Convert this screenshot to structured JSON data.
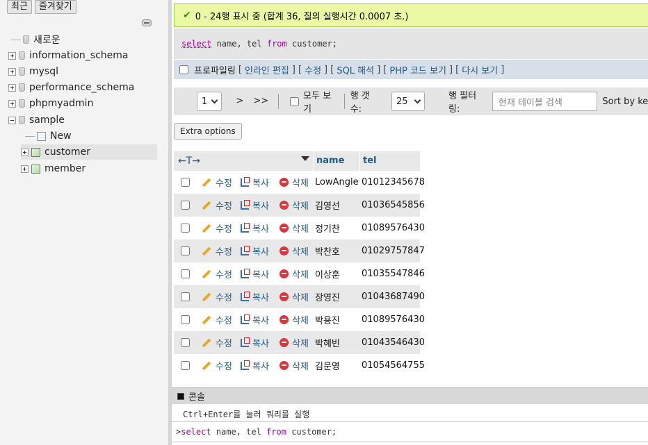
{
  "nav": {
    "tabs": [
      "최근",
      "즐겨찾기"
    ],
    "tree": [
      {
        "label": "새로운",
        "type": "new"
      },
      {
        "label": "information_schema",
        "type": "db"
      },
      {
        "label": "mysql",
        "type": "db"
      },
      {
        "label": "performance_schema",
        "type": "db"
      },
      {
        "label": "phpmyadmin",
        "type": "db"
      },
      {
        "label": "sample",
        "type": "db-open"
      },
      {
        "label": "New",
        "type": "table-new"
      },
      {
        "label": "customer",
        "type": "table",
        "selected": true
      },
      {
        "label": "member",
        "type": "table"
      }
    ]
  },
  "result": {
    "message": "0 - 24행 표시 중 (합계 36, 질의 실행시간 0.0007 초.)",
    "sql": {
      "k1": "select",
      "p1": " name, tel ",
      "k2": "from",
      "p2": " customer;"
    }
  },
  "profiling": {
    "label": "프로파일링",
    "links": [
      "인라인 편집",
      "수정",
      "SQL 해석",
      "PHP 코드 보기",
      "다시 보기"
    ]
  },
  "pager": {
    "page": "1",
    "next": ">",
    "last": ">>",
    "show_all": "모두 보기",
    "rows_label": "행 갯수:",
    "rows_value": "25",
    "filter_label": "행 필터링:",
    "filter_placeholder": "현재 테이블 검색",
    "sort_label": "Sort by key"
  },
  "extra_options": "Extra options",
  "table": {
    "columns": [
      "name",
      "tel"
    ],
    "arrows": "←T→",
    "actions": {
      "edit": "수정",
      "copy": "복사",
      "delete": "삭제"
    },
    "rows": [
      {
        "name": "LowAngle",
        "tel": "01012345678"
      },
      {
        "name": "김영선",
        "tel": "01036545856"
      },
      {
        "name": "정기찬",
        "tel": "01089576430"
      },
      {
        "name": "박찬호",
        "tel": "01029757847"
      },
      {
        "name": "이상훈",
        "tel": "01035547846"
      },
      {
        "name": "장영진",
        "tel": "01043687490"
      },
      {
        "name": "박용진",
        "tel": "01089576430"
      },
      {
        "name": "박혜빈",
        "tel": "01043546430"
      },
      {
        "name": "김문영",
        "tel": "01054564755"
      }
    ]
  },
  "console": {
    "title": "콘솔",
    "hint": "Ctrl+Enter를 눌러 쿼리를 실행",
    "prompt": ">",
    "sql": {
      "k1": "select",
      "p1": " name, tel ",
      "k2": "from",
      "p2": " customer;"
    }
  }
}
